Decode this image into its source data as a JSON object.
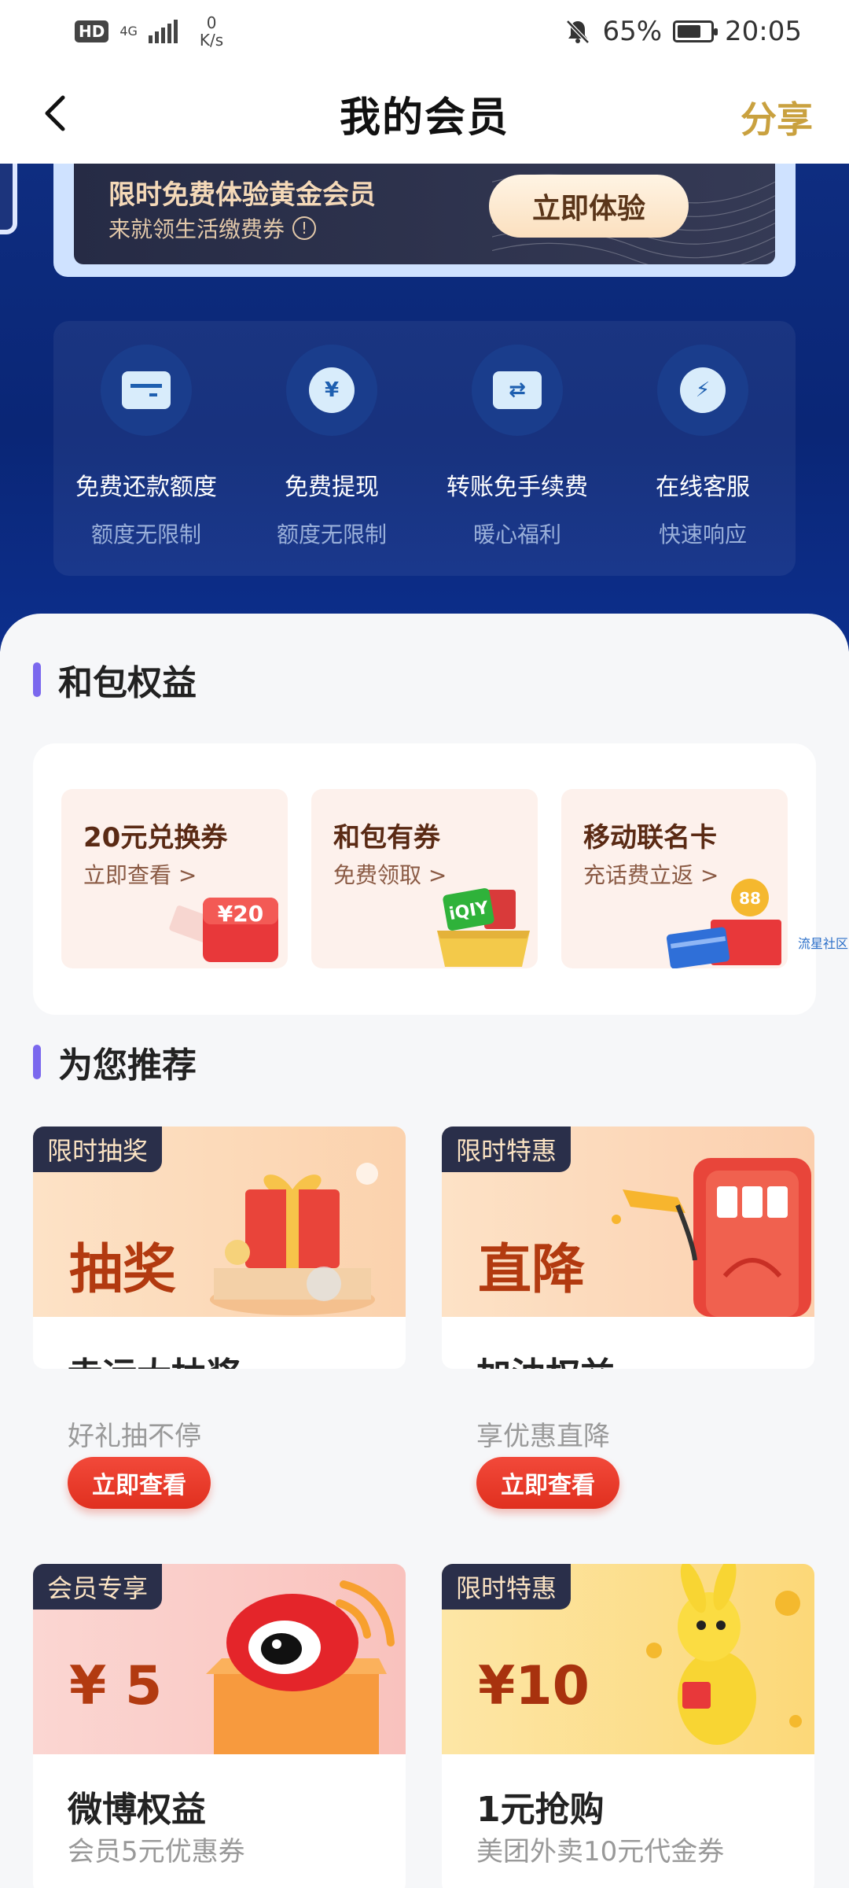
{
  "status_bar": {
    "hd": "HD",
    "network": "4G",
    "speed_value": "0",
    "speed_unit": "K/s",
    "battery": "65%",
    "time": "20:05"
  },
  "nav": {
    "title": "我的会员",
    "share": "分享"
  },
  "promo": {
    "title": "限时免费体验黄金会员",
    "subtitle": "来就领生活缴费券",
    "info": "!",
    "button": "立即体验"
  },
  "benefits": [
    {
      "icon": "card-icon",
      "glyph": "",
      "title": "免费还款额度",
      "sub": "额度无限制"
    },
    {
      "icon": "yen-icon",
      "glyph": "¥",
      "title": "免费提现",
      "sub": "额度无限制"
    },
    {
      "icon": "transfer-icon",
      "glyph": "⇄",
      "title": "转账免手续费",
      "sub": "暖心福利"
    },
    {
      "icon": "lightning-icon",
      "glyph": "⚡",
      "title": "在线客服",
      "sub": "快速响应"
    }
  ],
  "section_perks": {
    "title": "和包权益",
    "items": [
      {
        "title": "20元兑换券",
        "sub": "立即查看 >",
        "badge": "¥20"
      },
      {
        "title": "和包有券",
        "sub": "免费领取 >",
        "badge": "iQIY"
      },
      {
        "title": "移动联名卡",
        "sub": "充话费立返 >",
        "badge": "88"
      }
    ]
  },
  "watermark": "流星社区",
  "section_recommend": {
    "title": "为您推荐",
    "cards": [
      {
        "tag": "限时抽奖",
        "big": "抽奖",
        "title": "幸运大抽奖",
        "sub": "好礼抽不停",
        "button": "立即查看"
      },
      {
        "tag": "限时特惠",
        "big": "直降",
        "title": "加油权益",
        "sub": "享优惠直降",
        "button": "立即查看"
      },
      {
        "tag": "会员专享",
        "big": "¥ 5",
        "title": "微博权益",
        "sub": "会员5元优惠券",
        "button": ""
      },
      {
        "tag": "限时特惠",
        "big": "¥10",
        "title": "1元抢购",
        "sub": "美团外卖10元代金券",
        "button": ""
      }
    ]
  },
  "colors": {
    "hero": "#0e2d80",
    "accent_gold": "#c9a13f",
    "section_bar": "#7b68ee",
    "button_red": "#e0301f"
  }
}
